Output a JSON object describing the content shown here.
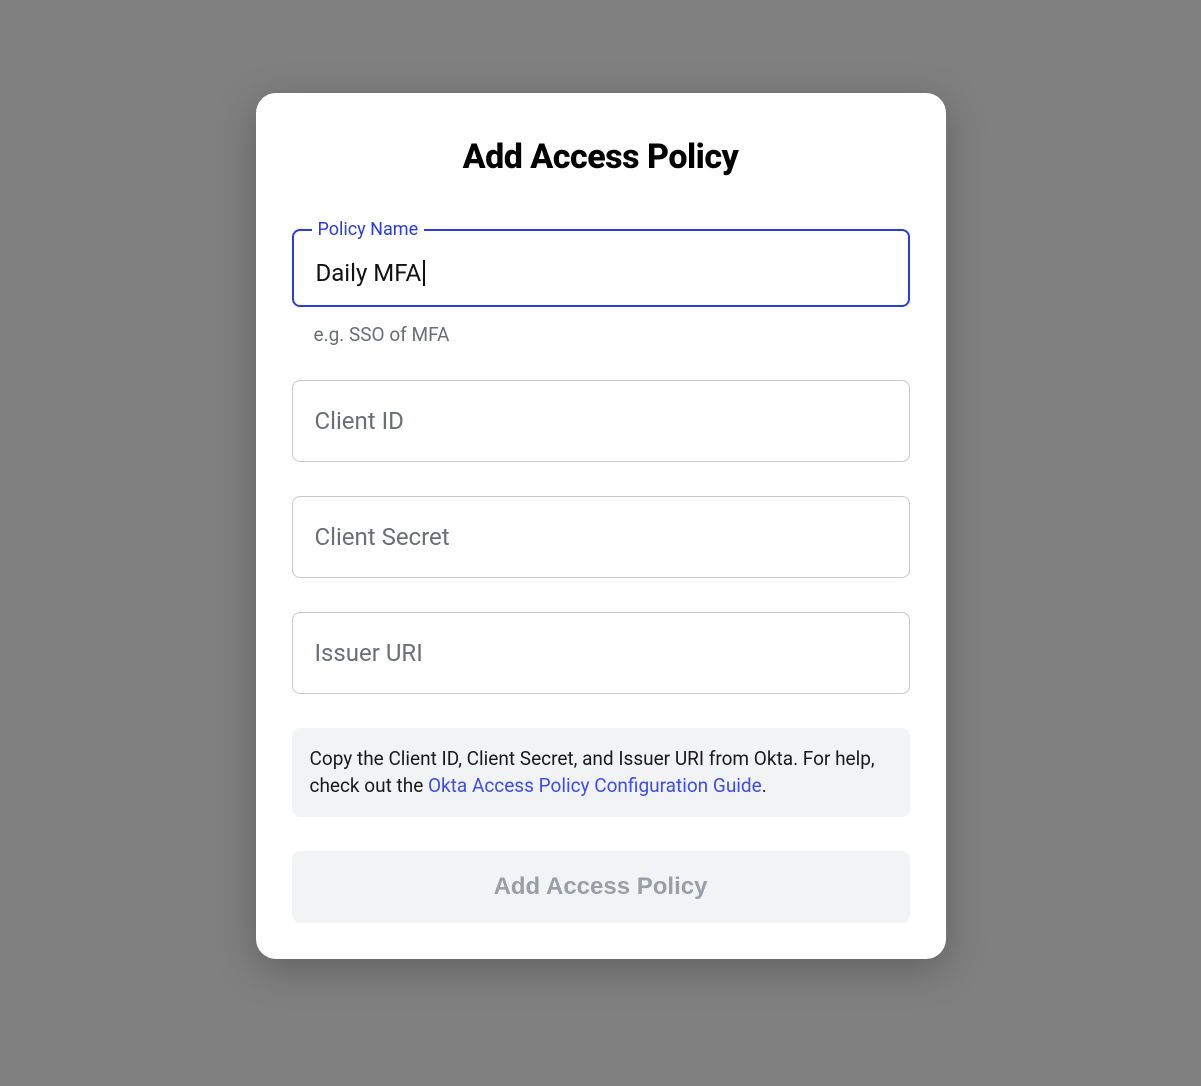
{
  "modal": {
    "title": "Add Access Policy",
    "fields": {
      "policyName": {
        "label": "Policy Name",
        "value": "Daily MFA",
        "helper": "e.g. SSO of MFA"
      },
      "clientId": {
        "placeholder": "Client ID"
      },
      "clientSecret": {
        "placeholder": "Client Secret"
      },
      "issuerUri": {
        "placeholder": "Issuer URI"
      }
    },
    "info": {
      "textBefore": "Copy the Client ID, Client Secret, and Issuer URI from Okta. For help, check out the ",
      "linkText": "Okta Access Policy Configuration Guide",
      "textAfter": "."
    },
    "submit": {
      "label": "Add Access Policy"
    }
  }
}
